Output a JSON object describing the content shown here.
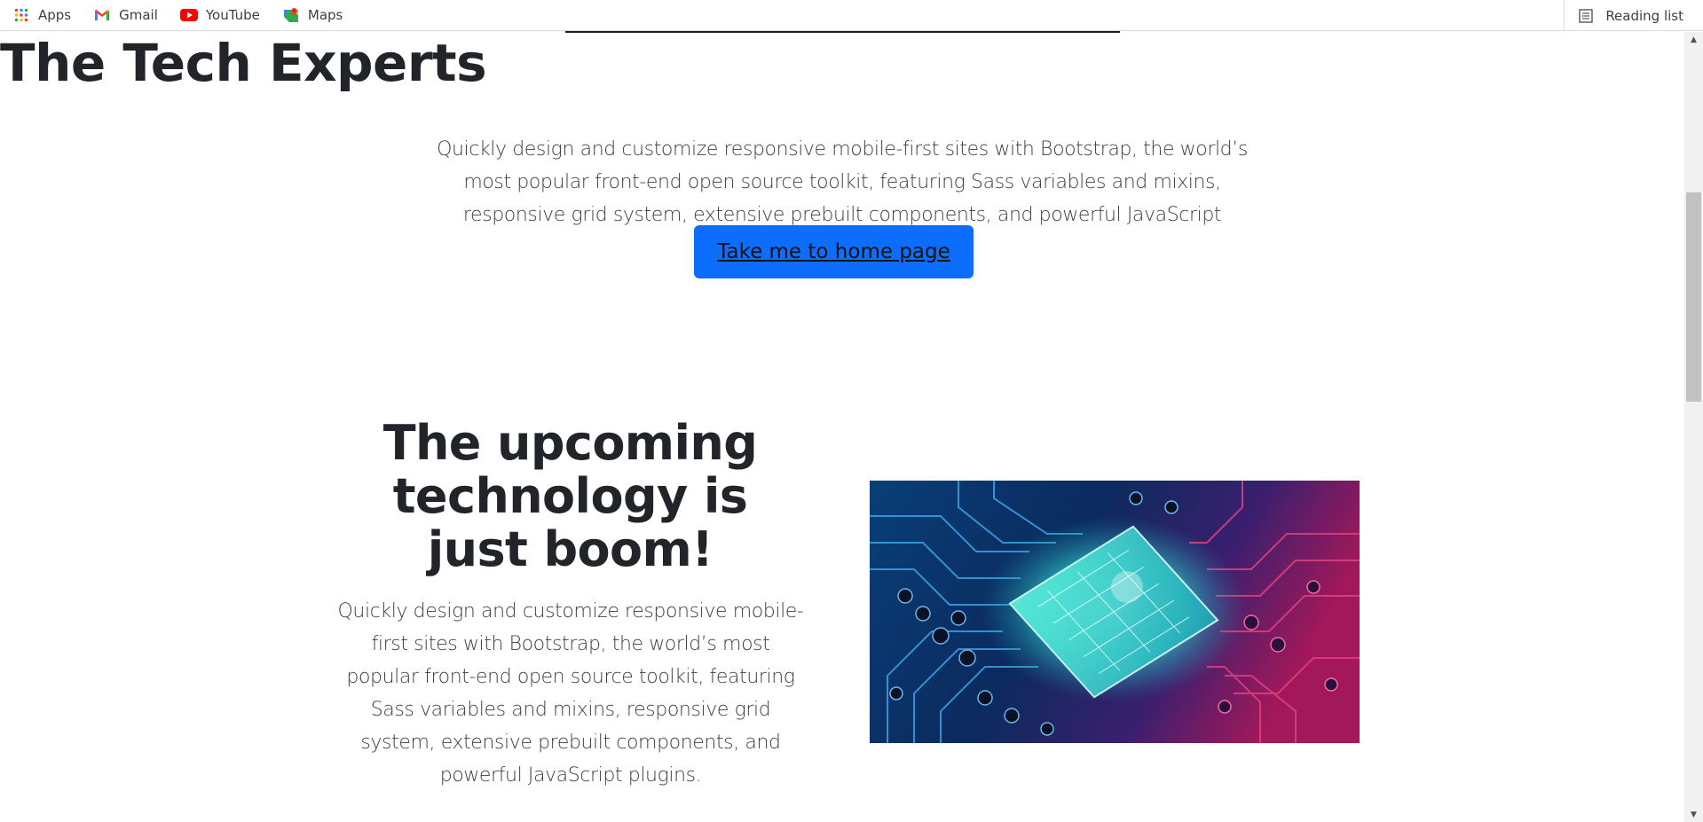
{
  "bookmarks": {
    "items": [
      {
        "label": "Apps",
        "icon": "apps-grid-icon"
      },
      {
        "label": "Gmail",
        "icon": "gmail-icon"
      },
      {
        "label": "YouTube",
        "icon": "youtube-icon"
      },
      {
        "label": "Maps",
        "icon": "maps-icon"
      }
    ],
    "reading_list": "Reading list"
  },
  "hero": {
    "title": "The Tech Experts",
    "lead": "Quickly design and customize responsive mobile-first sites with Bootstrap, the world’s most popular front-end open source toolkit, featuring Sass variables and mixins, responsive grid system, extensive prebuilt components, and powerful JavaScript plugins.",
    "button_label": "Take me to home page"
  },
  "feature": {
    "title": "The upcoming technology is just boom!",
    "text": "Quickly design and customize responsive mobile-first sites with Bootstrap, the world’s most popular front-end open source toolkit, featuring Sass variables and mixins, responsive grid system, extensive prebuilt components, and powerful JavaScript plugins."
  },
  "colors": {
    "button_bg": "#0d6efd",
    "heading": "#212529",
    "lead_text": "#3b4046"
  }
}
